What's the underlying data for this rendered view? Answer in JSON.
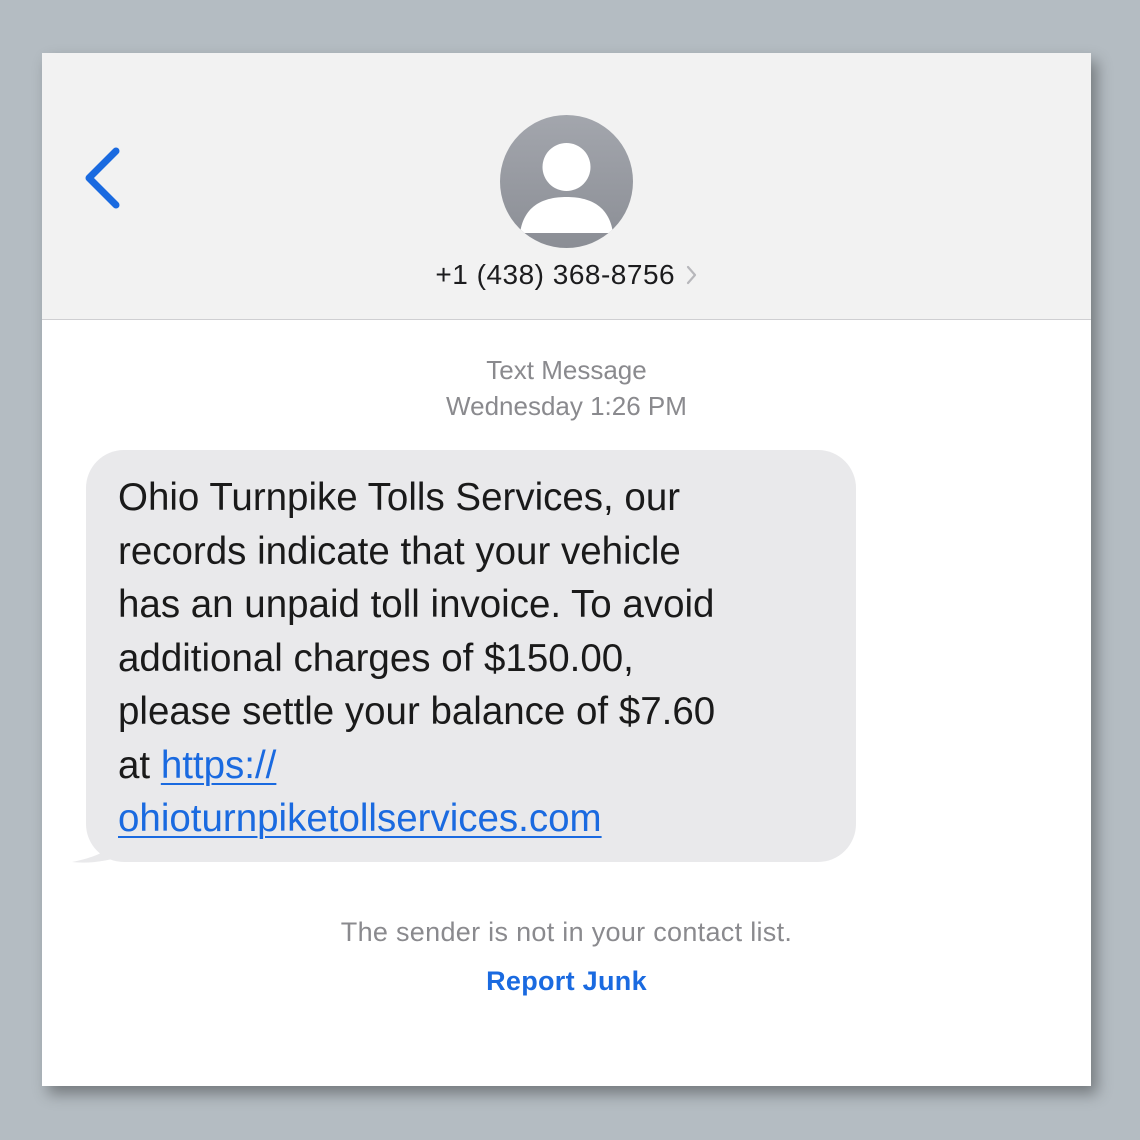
{
  "header": {
    "back_icon": "chevron-left-icon",
    "avatar_icon": "person-icon",
    "phone_number": "+1 (438) 368-8756",
    "details_icon": "chevron-right-icon"
  },
  "conversation": {
    "message_type": "Text Message",
    "timestamp": "Wednesday 1:26 PM",
    "message": {
      "text_lines": [
        "Ohio Turnpike Tolls Services, our",
        "records indicate that your vehicle",
        "has an unpaid toll invoice. To avoid",
        "additional charges of $150.00,",
        "please settle your balance of $7.60",
        "at "
      ],
      "link_line1": "https://",
      "link_line2": "ohioturnpiketollservices.com"
    }
  },
  "footer": {
    "unknown_sender_notice": "The sender is not in your contact list.",
    "report_junk_label": "Report Junk"
  },
  "colors": {
    "accent_blue": "#1a6ae0",
    "bubble_gray": "#e9e9eb",
    "header_bg": "#f2f2f2",
    "meta_gray": "#8a8a8e"
  }
}
